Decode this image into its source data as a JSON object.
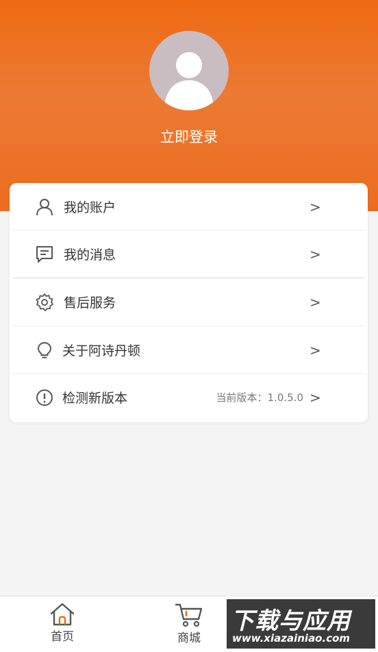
{
  "header": {
    "login_text": "立即登录",
    "avatar_icon": "user-avatar-icon",
    "bg_color": "#ee6a12"
  },
  "menu": {
    "items": [
      {
        "label": "我的账户",
        "icon": "user-icon",
        "arrow": ">"
      },
      {
        "label": "我的消息",
        "icon": "message-icon",
        "arrow": ">"
      },
      {
        "label": "售后服务",
        "icon": "gear-icon",
        "arrow": ">"
      },
      {
        "label": "关于阿诗丹顿",
        "icon": "lightbulb-icon",
        "arrow": ">"
      },
      {
        "label": "检测新版本",
        "icon": "info-icon",
        "arrow": ">",
        "meta": "当前版本：1.0.5.0"
      }
    ]
  },
  "tabbar": {
    "items": [
      {
        "label": "首页",
        "icon": "home-icon",
        "accent": "#ee6a12"
      },
      {
        "label": "商城",
        "icon": "cart-icon",
        "accent": "#ee6a12"
      }
    ]
  },
  "watermark": {
    "title": "下载与应用",
    "url": "www.xiazainiao.com"
  }
}
